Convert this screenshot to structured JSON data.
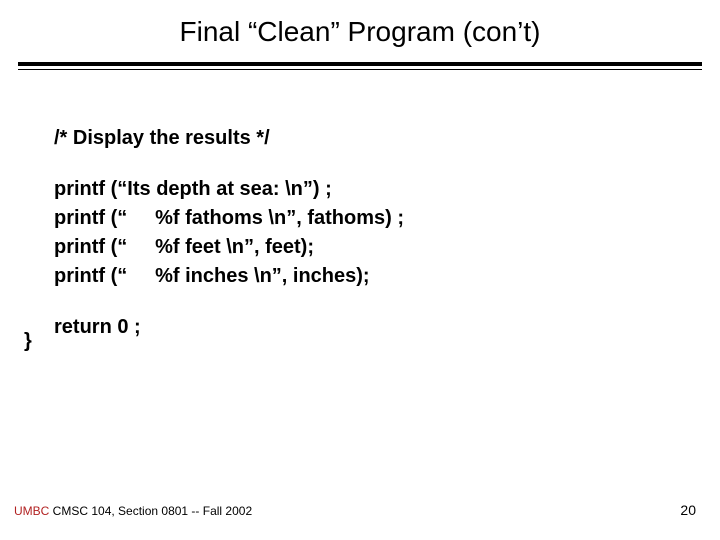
{
  "title": "Final “Clean” Program (con’t)",
  "comment": "/* Display the results */",
  "code": "printf (“Its depth at sea: \\n”) ;\nprintf (“     %f fathoms \\n”, fathoms) ;\nprintf (“     %f feet \\n”, feet);\nprintf (“     %f inches \\n”, inches);",
  "return_line": "return 0 ;",
  "brace": "}",
  "footer": {
    "org": "UMBC",
    "rest": " CMSC 104, Section 0801 -- Fall 2002",
    "page": "20"
  }
}
